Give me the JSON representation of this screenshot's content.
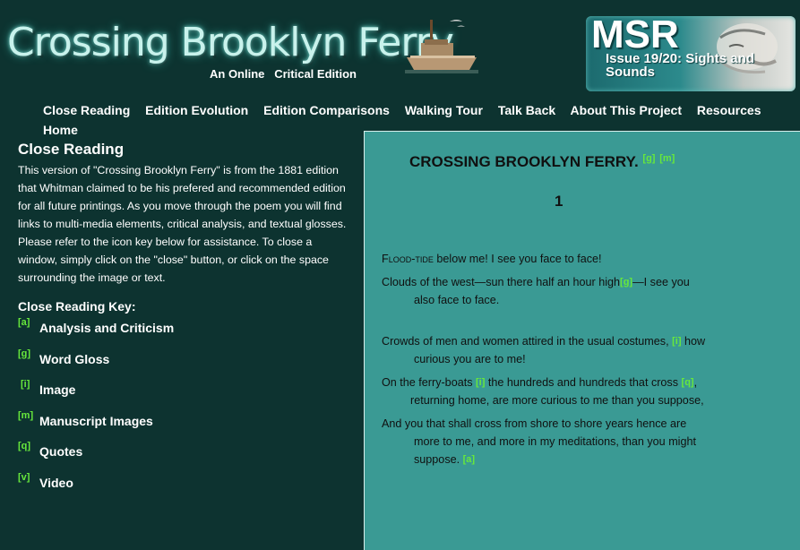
{
  "header": {
    "title": "Crossing Brooklyn Ferry",
    "subtitle": "An Online   Critical Edition",
    "badge_logo": "MSR",
    "badge_issue": "Issue 19/20: Sights and Sounds"
  },
  "nav": {
    "items": [
      "Close Reading",
      "Edition Evolution",
      "Edition Comparisons",
      "Walking Tour",
      "Talk Back",
      "About This Project",
      "Resources",
      "Home"
    ]
  },
  "left": {
    "heading": "Close Reading",
    "intro": "This version of \"Crossing Brooklyn Ferry\" is from the 1881 edition that Whitman claimed to be his prefered and recommended edition for all future printings. As you move through the poem you will find links to multi-media elements, critical analysis, and textual glosses. Please refer to the icon key below for assistance. To close a window, simply click on the \"close\" button, or click on the space surrounding the image or text.",
    "key_heading": "Close Reading Key:",
    "key": [
      {
        "tag": "[a]",
        "label": "Analysis and Criticism"
      },
      {
        "tag": "[g]",
        "label": "Word Gloss"
      },
      {
        "tag": "[i]",
        "label": "Image"
      },
      {
        "tag": "[m]",
        "label": "Manuscript Images"
      },
      {
        "tag": "[q]",
        "label": "Quotes"
      },
      {
        "tag": "[v]",
        "label": "Video"
      }
    ]
  },
  "poem": {
    "title": "CROSSING BROOKLYN FERRY.",
    "title_marks": [
      "[g]",
      "[m]"
    ],
    "section": "1",
    "l1_lead": "Flood-tide",
    "l1_rest": " below me! I see you face to face!",
    "l2_a": "Clouds of the west—sun there half an hour high",
    "l2_mark": "[g]",
    "l2_b": "—I see you",
    "l2_c": "also face to face.",
    "l3_a": "Crowds of men and women attired in the usual costumes,",
    "l3_mark": "[i]",
    "l3_b": " how",
    "l3_c": "curious you are to me!",
    "l4_a": "On the ferry-boats",
    "l4_mark1": "[i]",
    "l4_b": " the hundreds and hundreds that cross",
    "l4_mark2": "[q]",
    "l4_c": ",",
    "l4_d": "returning home, are more curious to me than you suppose,",
    "l5_a": "And you that shall cross from shore to shore years hence are",
    "l5_b": "more to me, and more in my meditations, than you might",
    "l5_c": "suppose.",
    "l5_mark": "[a]"
  },
  "colors": {
    "background": "#0d3330",
    "panel": "#3a9a94",
    "mark": "#67e83c"
  }
}
